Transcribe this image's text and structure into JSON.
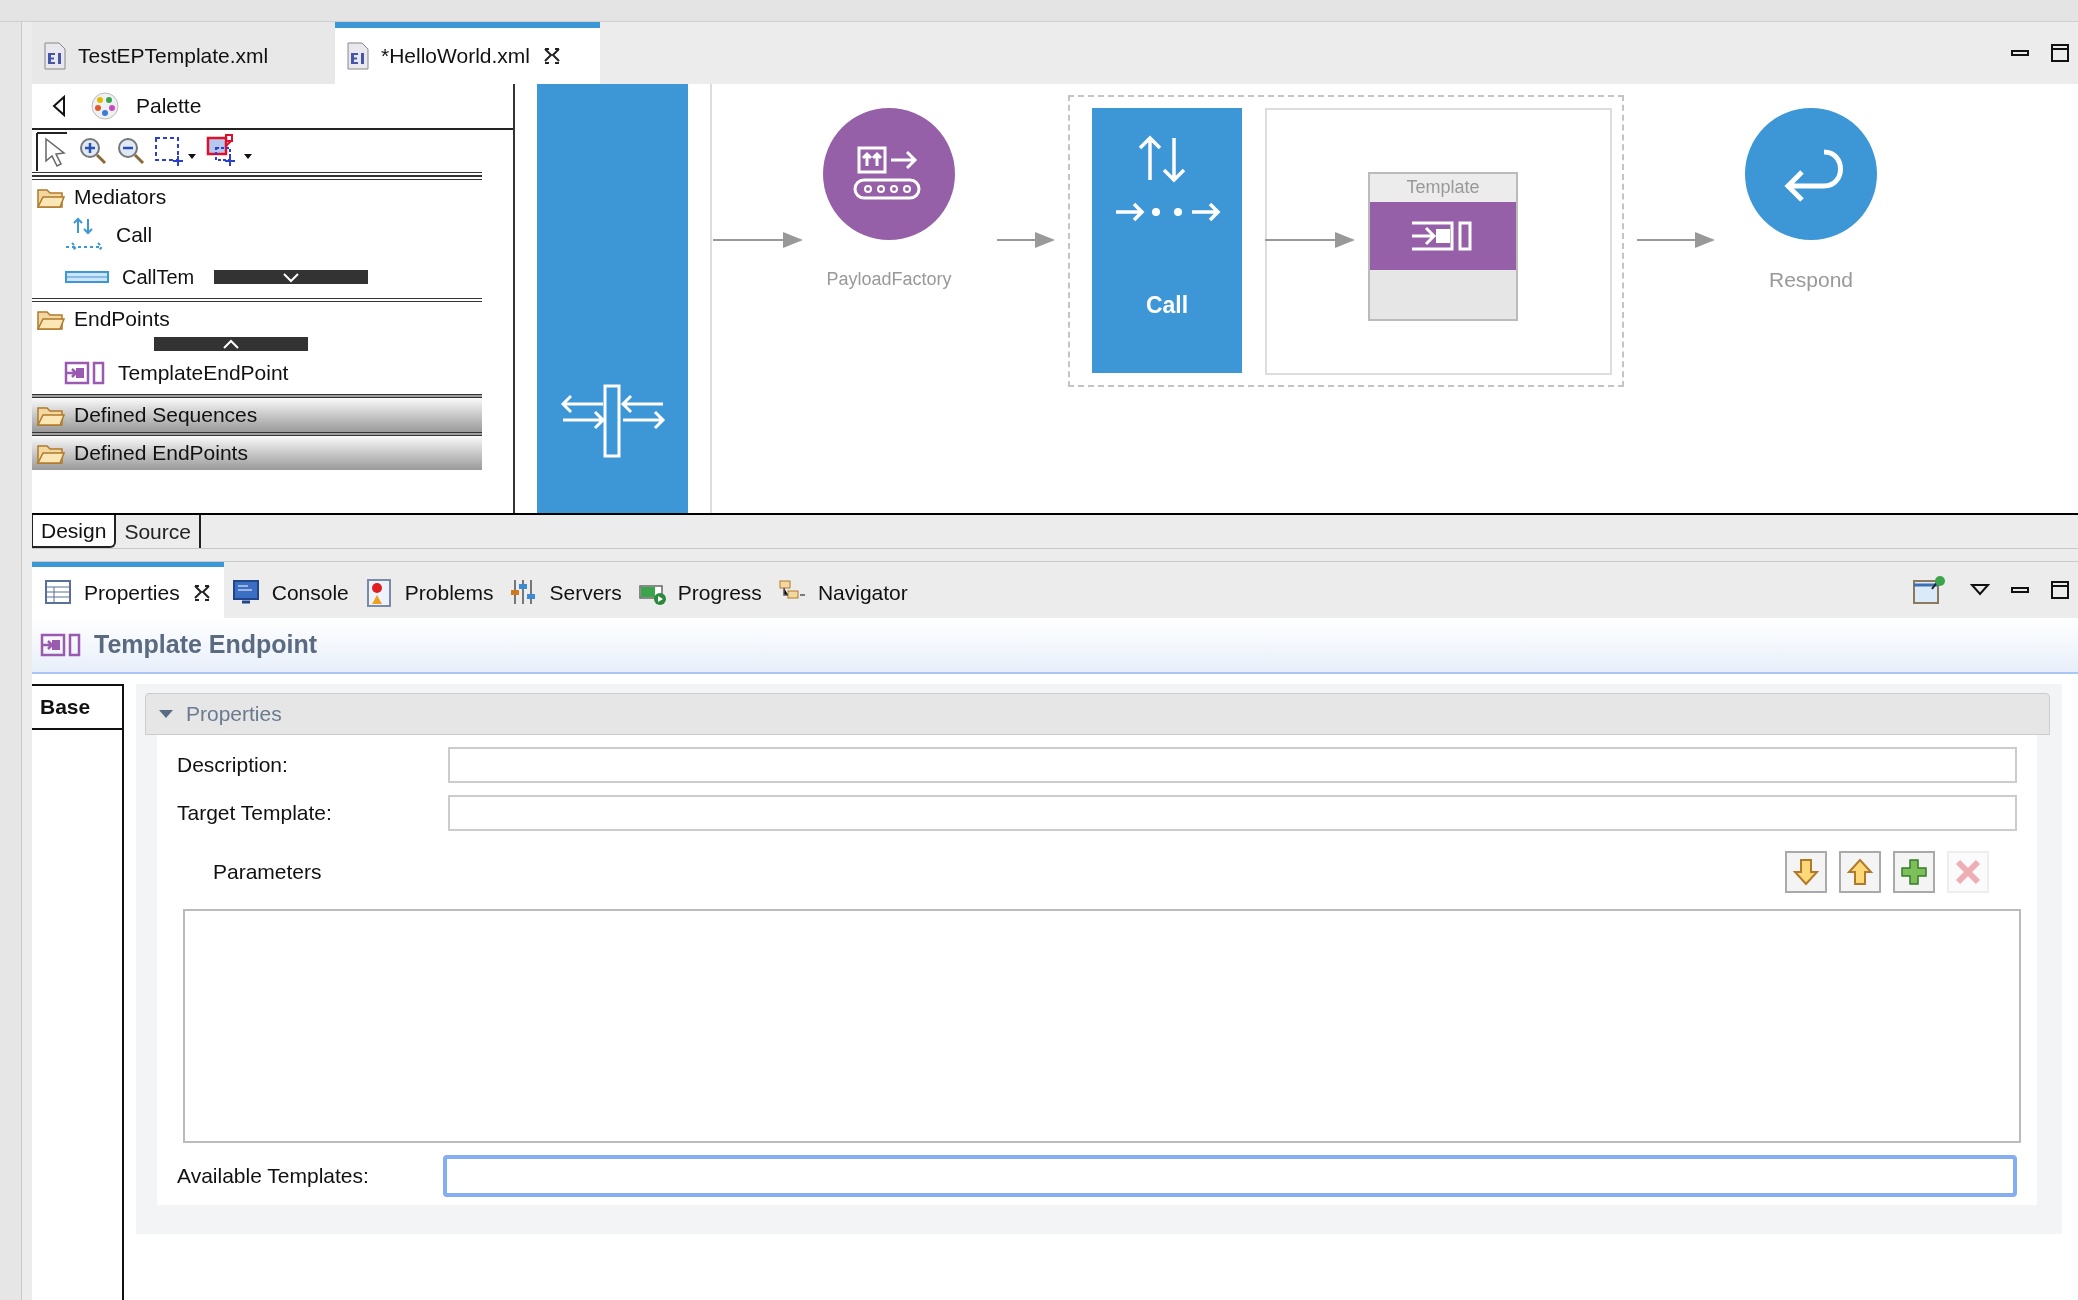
{
  "editor_tabs": [
    {
      "label": "TestEPTemplate.xml",
      "selected": false
    },
    {
      "label": "*HelloWorld.xml",
      "selected": true
    }
  ],
  "palette": {
    "title": "Palette",
    "drawers": [
      {
        "label": "Mediators",
        "expanded": true,
        "items": [
          {
            "label": "Call",
            "kind": "call"
          },
          {
            "label": "CallTem",
            "kind": "calltemplate"
          }
        ]
      },
      {
        "label": "EndPoints",
        "expanded": true,
        "items": [
          {
            "label": "TemplateEndPoint",
            "kind": "templateendpoint"
          }
        ]
      },
      {
        "label": "Defined Sequences",
        "expanded": false
      },
      {
        "label": "Defined EndPoints",
        "expanded": false
      }
    ]
  },
  "editor_mode_tabs": [
    {
      "label": "Design",
      "selected": true
    },
    {
      "label": "Source",
      "selected": false
    }
  ],
  "diagram": {
    "nodes": [
      {
        "kind": "payload",
        "label": "PayloadFactory"
      },
      {
        "kind": "call",
        "label": "Call"
      },
      {
        "kind": "template",
        "label": "Template"
      },
      {
        "kind": "respond",
        "label": "Respond"
      }
    ]
  },
  "view_tabs": [
    {
      "label": "Properties",
      "kind": "properties",
      "selected": true
    },
    {
      "label": "Console",
      "kind": "console",
      "selected": false
    },
    {
      "label": "Problems",
      "kind": "problems",
      "selected": false
    },
    {
      "label": "Servers",
      "kind": "servers",
      "selected": false
    },
    {
      "label": "Progress",
      "kind": "progress",
      "selected": false
    },
    {
      "label": "Navigator",
      "kind": "navigator",
      "selected": false
    }
  ],
  "properties": {
    "title": "Template Endpoint",
    "side_tabs": [
      {
        "label": "Base",
        "selected": true
      }
    ],
    "section": {
      "title": "Properties",
      "expanded": true
    },
    "fields": [
      {
        "label": "Description:"
      },
      {
        "label": "Target Template:"
      }
    ],
    "parameters": {
      "label": "Parameters",
      "buttons": [
        {
          "kind": "down",
          "disabled": false
        },
        {
          "kind": "up",
          "disabled": false
        },
        {
          "kind": "add",
          "disabled": false
        },
        {
          "kind": "remove",
          "disabled": true
        }
      ]
    },
    "available": {
      "label": "Available Templates:",
      "focused": true
    }
  }
}
